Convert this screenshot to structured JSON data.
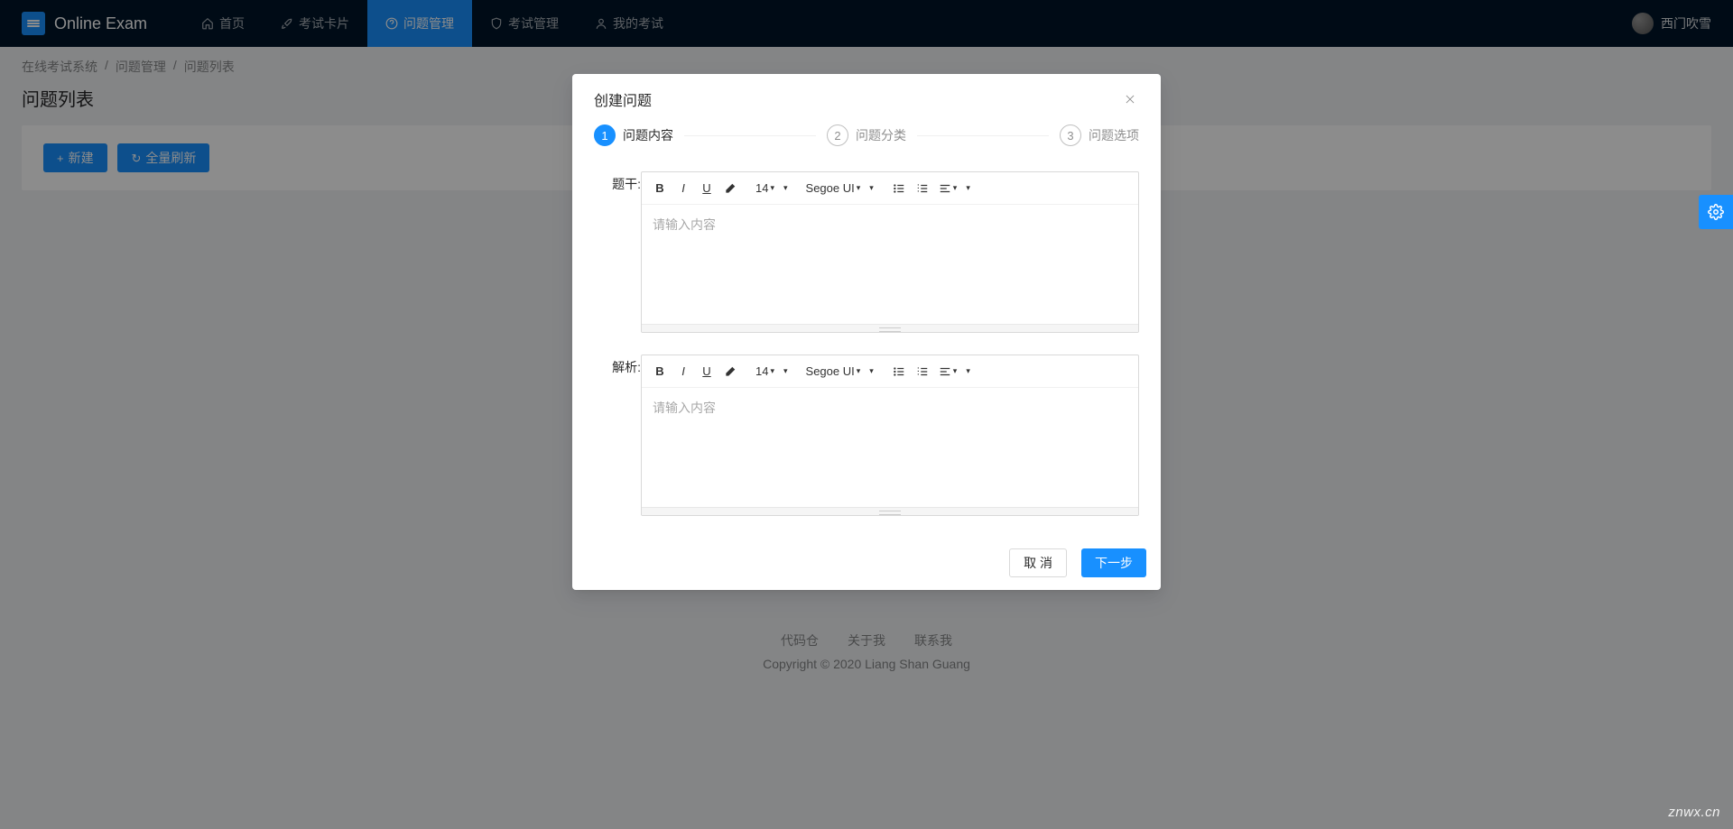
{
  "brand": "Online Exam",
  "nav": [
    {
      "label": "首页",
      "active": false,
      "icon": "home"
    },
    {
      "label": "考试卡片",
      "active": false,
      "icon": "rocket"
    },
    {
      "label": "问题管理",
      "active": true,
      "icon": "question"
    },
    {
      "label": "考试管理",
      "active": false,
      "icon": "safety"
    },
    {
      "label": "我的考试",
      "active": false,
      "icon": "user"
    }
  ],
  "user": {
    "name": "西门吹雪"
  },
  "breadcrumb": [
    "在线考试系统",
    "问题管理",
    "问题列表"
  ],
  "page_title": "问题列表",
  "actions": {
    "new": "新建",
    "refresh": "全量刷新"
  },
  "footer": {
    "links": [
      "代码仓",
      "关于我",
      "联系我"
    ],
    "copyright": "Copyright © 2020 Liang Shan Guang"
  },
  "modal": {
    "title": "创建问题",
    "steps": [
      {
        "num": "1",
        "title": "问题内容",
        "state": "active"
      },
      {
        "num": "2",
        "title": "问题分类",
        "state": "wait"
      },
      {
        "num": "3",
        "title": "问题选项",
        "state": "wait"
      }
    ],
    "labels": {
      "stem": "题干:",
      "analysis": "解析:"
    },
    "toolbar": {
      "font_size": "14",
      "font_family": "Segoe UI"
    },
    "placeholder": "请输入内容",
    "footer": {
      "cancel": "取 消",
      "next": "下一步"
    }
  },
  "watermark": "znwx.cn"
}
